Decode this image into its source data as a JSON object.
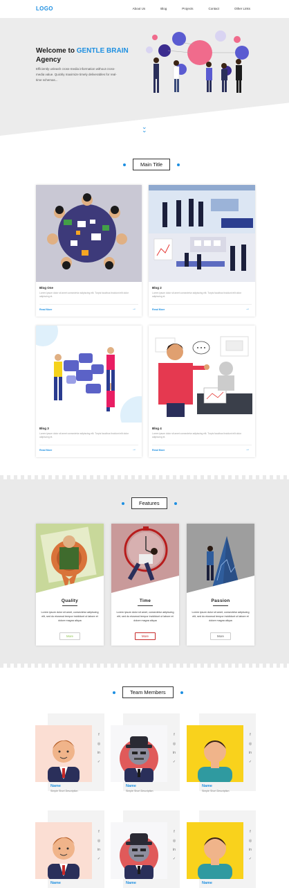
{
  "nav": {
    "logo": "LOGO",
    "items": [
      "About Us",
      "Blog",
      "Projects",
      "Contact",
      "Other Links"
    ]
  },
  "hero": {
    "title_prefix": "Welcome to ",
    "title_accent": "GENTLE BRAIN",
    "title_suffix": "Agency",
    "description": "Efficiently unleash cross-media information without cross-media value. Quickly maximize timely deliverables for real-time schemas..."
  },
  "main": {
    "title": "Main Title"
  },
  "blogs": [
    {
      "title": "Blog One",
      "desc": "Lorem ipsum dolor sit amet consectetur adipiscing elit. Turpis faucibus tincidunt elit dolor adipiscing et.",
      "more": "Read More"
    },
    {
      "title": "Blog 2",
      "desc": "Lorem ipsum dolor sit amet consectetur adipiscing elit. Turpis faucibus tincidunt elit dolor adipiscing et.",
      "more": "Read More"
    },
    {
      "title": "Blog 3",
      "desc": "Lorem ipsum dolor sit amet consectetur adipiscing elit. Turpis faucibus tincidunt elit dolor adipiscing et.",
      "more": "Read More"
    },
    {
      "title": "Blog 4",
      "desc": "Lorem ipsum dolor sit amet consectetur adipiscing elit. Turpis faucibus tincidunt elit dolor adipiscing et.",
      "more": "Read More"
    }
  ],
  "features": {
    "title": "Features",
    "items": [
      {
        "title": "Quality",
        "desc": "Lorem ipsum dolor sit amet, consectetur adipiscing elit, sed do eiusmod tempor incididunt ut labore et dolore magna aliqua",
        "btn": "More",
        "color": "#8bc34a"
      },
      {
        "title": "Time",
        "desc": "Lorem ipsum dolor sit amet, consectetur adipiscing elit, sed do eiusmod tempor incididunt ut labore et dolore magna aliqua",
        "btn": "More",
        "color": "#c62828"
      },
      {
        "title": "Passion",
        "desc": "Lorem ipsum dolor sit amet, consectetur adipiscing elit, sed do eiusmod tempor incididunt ut labore et dolore magna aliqua",
        "btn": "More",
        "color": "#777777"
      }
    ]
  },
  "team": {
    "title": "Team Members",
    "members": [
      {
        "name": "Name",
        "desc": "Simple Short Description"
      },
      {
        "name": "Name",
        "desc": "Simple Short Description"
      },
      {
        "name": "Name",
        "desc": "Simple Short Description"
      },
      {
        "name": "Name",
        "desc": ""
      },
      {
        "name": "Name",
        "desc": ""
      },
      {
        "name": "Name",
        "desc": ""
      }
    ],
    "social_icons": [
      "facebook-icon",
      "instagram-icon",
      "linkedin-icon",
      "twitter-icon"
    ]
  },
  "colors": {
    "accent": "#1d8fe1"
  }
}
